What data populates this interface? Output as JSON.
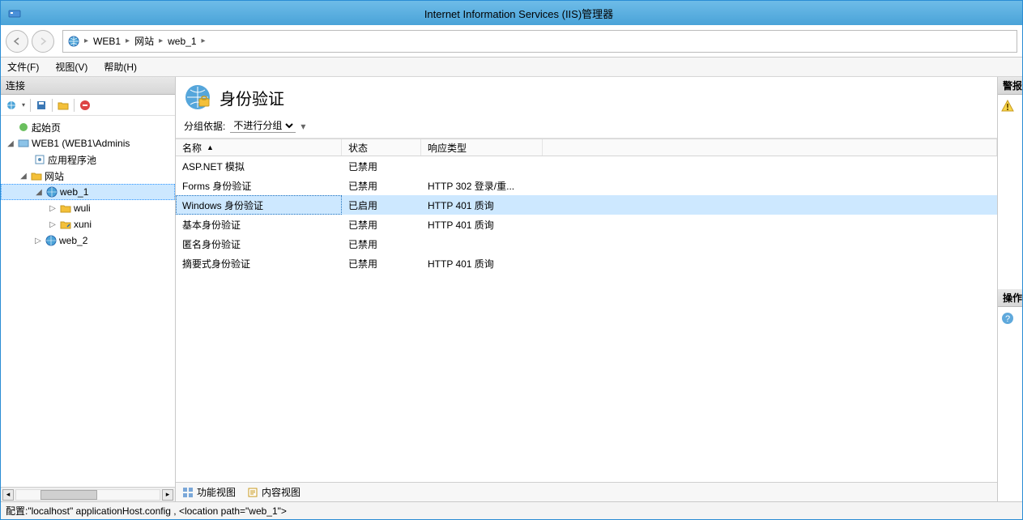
{
  "title": "Internet Information Services (IIS)管理器",
  "breadcrumbs": [
    "WEB1",
    "网站",
    "web_1"
  ],
  "menus": {
    "file": "文件(F)",
    "view": "视图(V)",
    "help": "帮助(H)"
  },
  "left": {
    "header": "连接",
    "tree": {
      "start": "起始页",
      "server": "WEB1 (WEB1\\Adminis",
      "apppools": "应用程序池",
      "sites": "网站",
      "web1": "web_1",
      "wuli": "wuli",
      "xuni": "xuni",
      "web2": "web_2"
    }
  },
  "center": {
    "title": "身份验证",
    "group_label": "分组依据:",
    "group_value": "不进行分组",
    "columns": {
      "name": "名称",
      "state": "状态",
      "resp": "响应类型"
    },
    "rows": [
      {
        "name": "ASP.NET 模拟",
        "state": "已禁用",
        "resp": ""
      },
      {
        "name": "Forms 身份验证",
        "state": "已禁用",
        "resp": "HTTP 302 登录/重..."
      },
      {
        "name": "Windows 身份验证",
        "state": "已启用",
        "resp": "HTTP 401 质询",
        "selected": true
      },
      {
        "name": "基本身份验证",
        "state": "已禁用",
        "resp": "HTTP 401 质询"
      },
      {
        "name": "匿名身份验证",
        "state": "已禁用",
        "resp": ""
      },
      {
        "name": "摘要式身份验证",
        "state": "已禁用",
        "resp": "HTTP 401 质询"
      }
    ],
    "tabs": {
      "features": "功能视图",
      "content": "内容视图"
    }
  },
  "right": {
    "alerts_hdr": "警报",
    "actions_hdr": "操作"
  },
  "status": "配置:\"localhost\" applicationHost.config , <location path=\"web_1\">"
}
